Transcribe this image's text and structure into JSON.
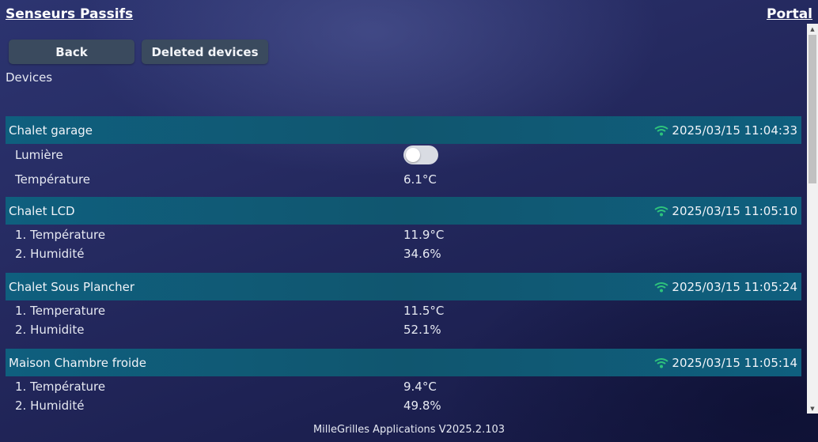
{
  "header": {
    "title": "Senseurs Passifs",
    "portal_link": "Portal"
  },
  "toolbar": {
    "back_label": "Back",
    "deleted_devices_label": "Deleted devices"
  },
  "section": {
    "label": "Devices"
  },
  "devices": [
    {
      "name": "Chalet garage",
      "last_seen": "2025/03/15 11:04:33",
      "status_icon": "wifi-icon",
      "rows": [
        {
          "label": "Lumière",
          "toggle_on": false
        },
        {
          "label": "Température",
          "value": "6.1°C"
        }
      ]
    },
    {
      "name": "Chalet LCD",
      "last_seen": "2025/03/15 11:05:10",
      "status_icon": "wifi-icon",
      "rows": [
        {
          "label": "1. Température",
          "value": "11.9°C"
        },
        {
          "label": "2. Humidité",
          "value": "34.6%"
        }
      ]
    },
    {
      "name": "Chalet Sous Plancher",
      "last_seen": "2025/03/15 11:05:24",
      "status_icon": "wifi-icon",
      "rows": [
        {
          "label": "1. Temperature",
          "value": "11.5°C"
        },
        {
          "label": "2. Humidite",
          "value": "52.1%"
        }
      ]
    },
    {
      "name": "Maison Chambre froide",
      "last_seen": "2025/03/15 11:05:14",
      "status_icon": "wifi-icon",
      "rows": [
        {
          "label": "1. Température",
          "value": "9.4°C"
        },
        {
          "label": "2. Humidité",
          "value": "49.8%"
        }
      ]
    }
  ],
  "footer": {
    "version_text": "MilleGrilles Applications V2025.2.103"
  },
  "colors": {
    "background": "#262b62",
    "device_header": "#0f5f7e",
    "button": "#3a4a5e",
    "wifi_online": "#2ec37c",
    "text": "#e6e9f2"
  }
}
